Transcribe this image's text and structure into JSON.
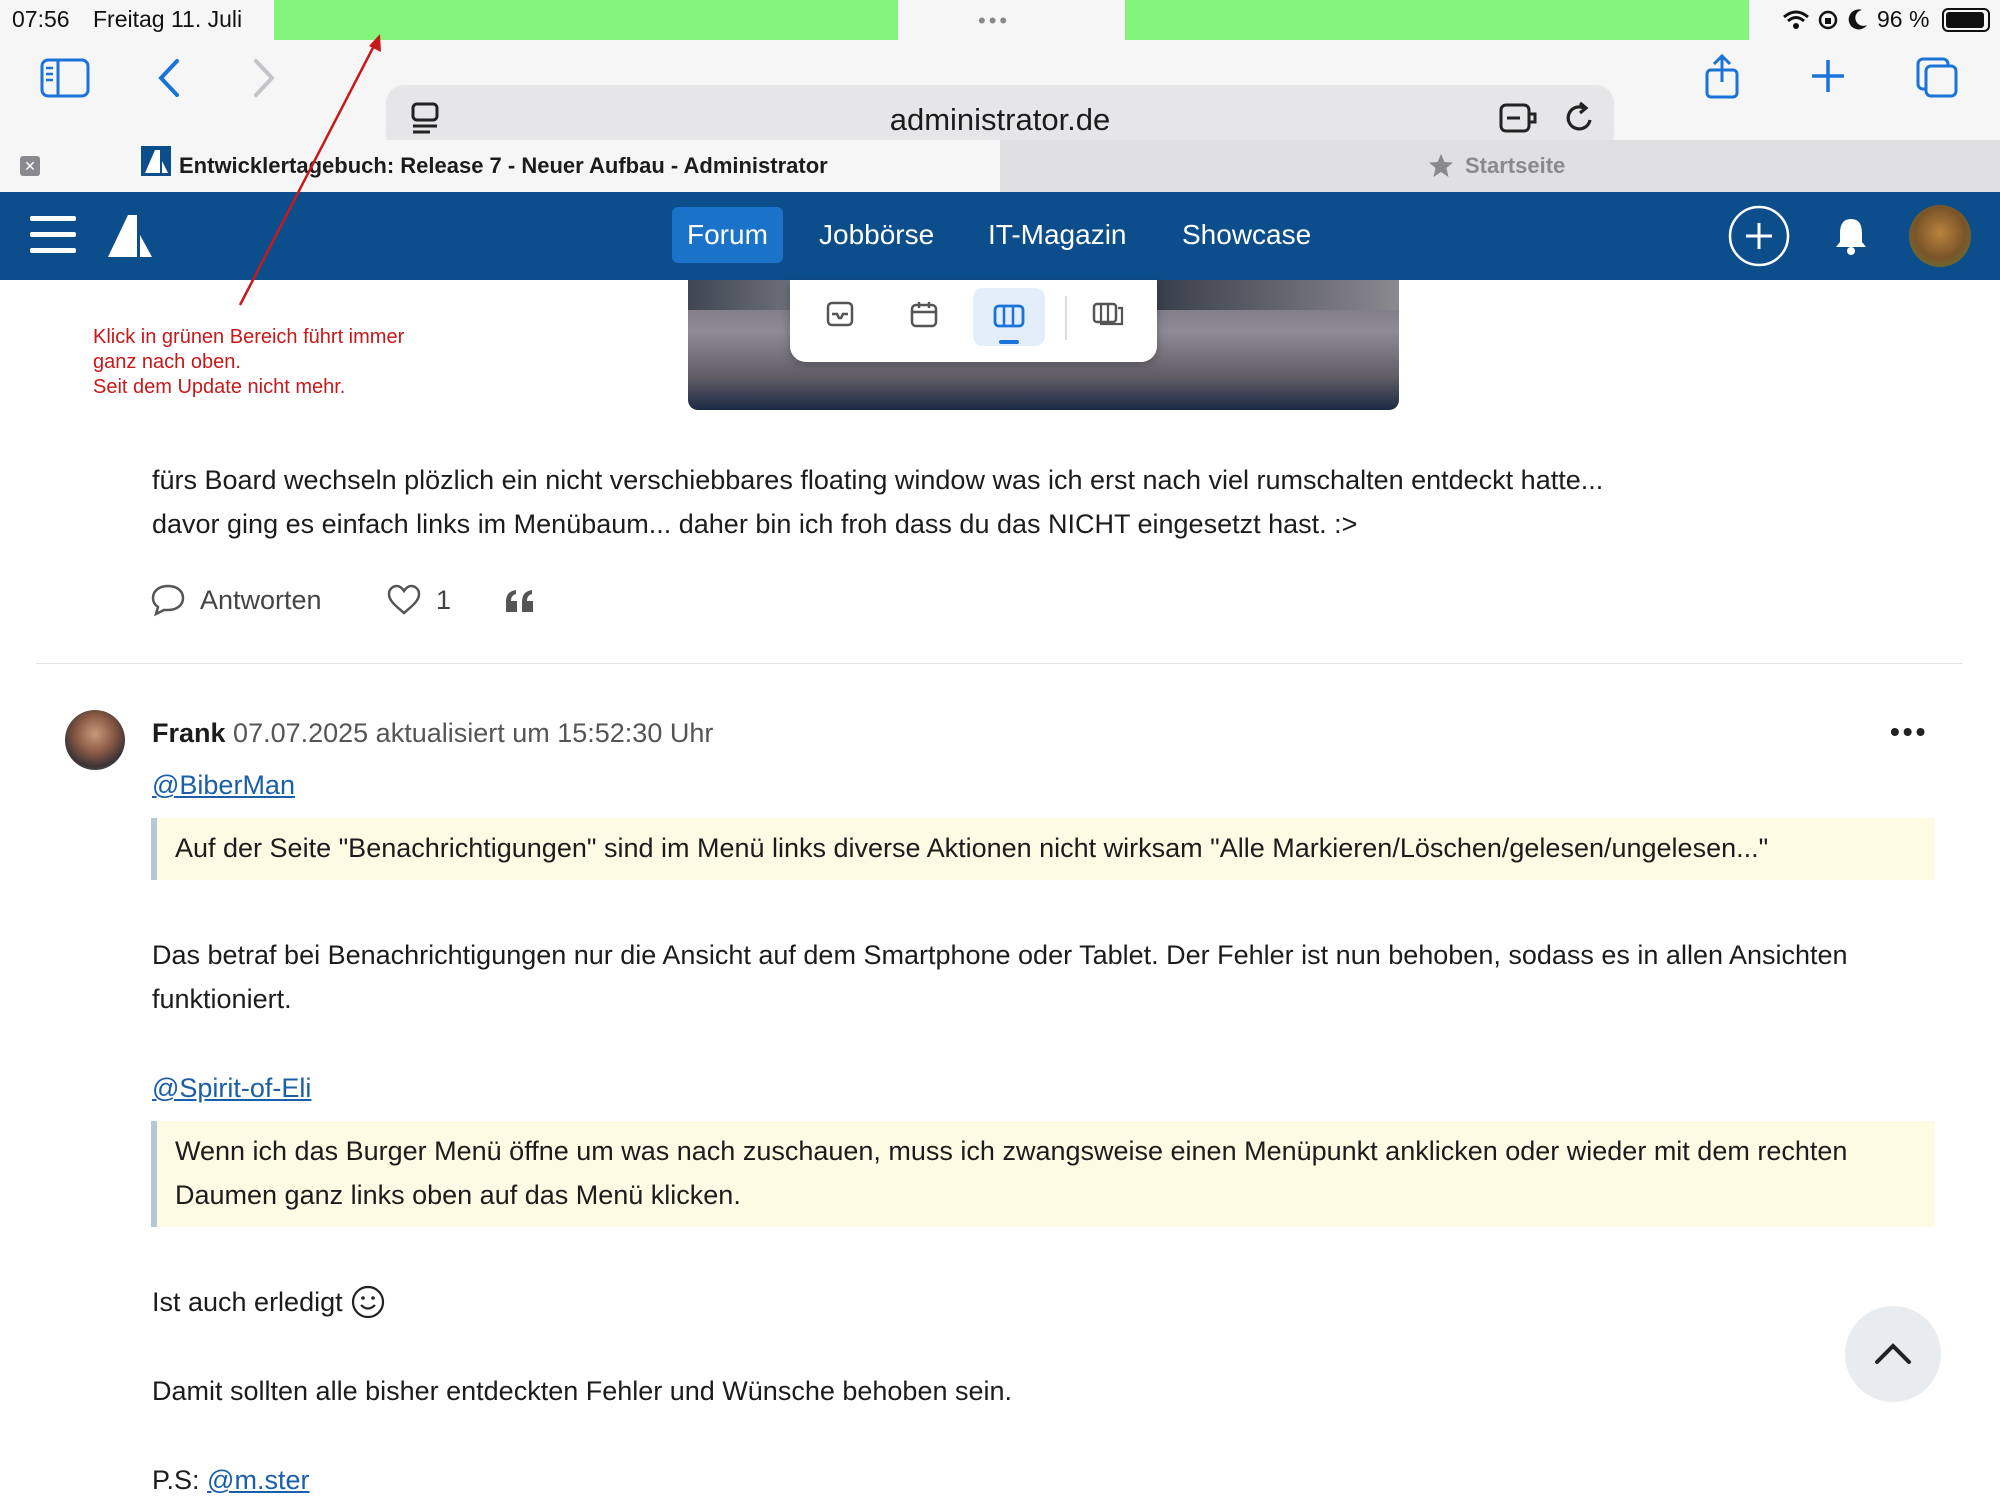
{
  "status_bar": {
    "time": "07:56",
    "date": "Freitag 11. Juli",
    "battery": "96 %",
    "dots": "•••"
  },
  "browser": {
    "url": "administrator.de",
    "tabs": [
      {
        "label": "Entwicklertagebuch: Release 7 - Neuer Aufbau - Administrator"
      },
      {
        "label": "Startseite"
      }
    ]
  },
  "annotation": {
    "lines": [
      "Klick in grünen Bereich führt immer",
      "ganz nach oben.",
      "Seit dem Update nicht mehr."
    ]
  },
  "header": {
    "nav": [
      "Forum",
      "Jobbörse",
      "IT-Magazin",
      "Showcase"
    ]
  },
  "previous_post": {
    "text_lines": [
      "fürs Board wechseln plözlich ein nicht verschiebbares floating window was ich erst nach viel rumschalten entdeckt hatte...",
      "davor ging es einfach links im Menübaum... daher bin ich froh dass du das NICHT eingesetzt hast. :>"
    ],
    "reply_label": "Antworten",
    "like_count": "1"
  },
  "post": {
    "author": "Frank",
    "meta": "07.07.2025 aktualisiert um 15:52:30 Uhr",
    "mention1": "@BiberMan",
    "quote1": "Auf der Seite \"Benachrichtigungen\" sind im Menü links diverse Aktionen nicht wirksam \"Alle Markieren/Löschen/gelesen/ungelesen...\"",
    "para1": "Das betraf bei Benachrichtigungen nur die Ansicht auf dem Smartphone oder Tablet. Der Fehler ist nun behoben, sodass es in allen Ansichten funktioniert.",
    "mention2": "@Spirit-of-Eli",
    "quote2": "Wenn ich das Burger Menü öffne um was nach zuschauen, muss ich zwangsweise einen Menüpunkt anklicken oder wieder mit dem rechten Daumen ganz links oben auf das Menü klicken.",
    "para2": "Ist auch erledigt",
    "para3": "Damit sollten alle bisher entdeckten Fehler und Wünsche behoben sein.",
    "ps_prefix": "P.S: ",
    "ps_mention": "@m.ster"
  }
}
